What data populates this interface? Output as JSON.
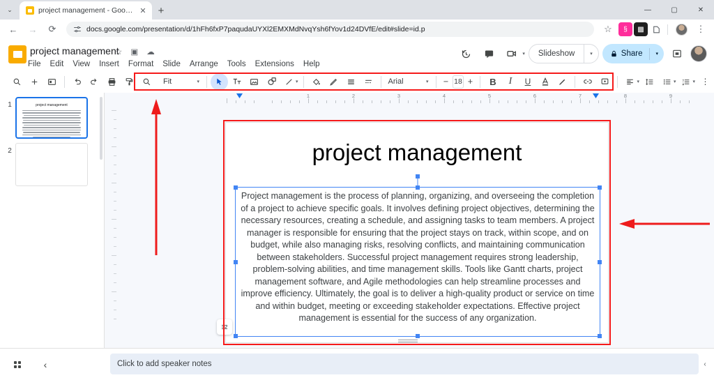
{
  "browser": {
    "tab": {
      "title": "project management - Google S",
      "favicon": "slides-favicon",
      "close": "✕"
    },
    "new_tab_label": "+",
    "tab_search": "⌄",
    "window_controls": {
      "minimize": "—",
      "maximize": "▢",
      "close": "✕"
    },
    "nav": {
      "back": "←",
      "forward": "→",
      "reload": "⟳"
    },
    "url": "docs.google.com/presentation/d/1hFh6fxP7paqudaUYXl2EMXMdNvqYsh6fYov1d24DVfE/edit#slide=id.p",
    "site_info_icon": "tune-icon",
    "bookmark_star": "☆",
    "extensions": [
      "extension-pink-icon",
      "extension-dark-icon",
      "extension-outline-icon"
    ],
    "menu": "⋮"
  },
  "docs": {
    "app_icon": "google-slides-icon",
    "title": "project management",
    "title_icons": [
      "star-icon",
      "move-to-folder-icon",
      "cloud-saved-icon"
    ],
    "menus": [
      "File",
      "Edit",
      "View",
      "Insert",
      "Format",
      "Slide",
      "Arrange",
      "Tools",
      "Extensions",
      "Help"
    ],
    "header_actions": {
      "history_icon": "version-history-icon",
      "comment_icon": "comment-icon",
      "meet_icon": "present-meet-icon",
      "meet_caret": "▾",
      "slideshow_label": "Slideshow",
      "slideshow_caret": "▾",
      "share_label": "Share",
      "share_lock_icon": "lock-icon",
      "share_caret": "▾",
      "present_icon": "present-icon",
      "avatar": "user-avatar"
    }
  },
  "toolbar": {
    "left_group": [
      {
        "name": "search-icon",
        "glyph": "🔍"
      },
      {
        "name": "add-slide-icon",
        "glyph": "+"
      },
      {
        "name": "layout-icon",
        "glyph": "▤"
      }
    ],
    "history_group": [
      {
        "name": "undo-icon",
        "glyph": "↶"
      },
      {
        "name": "redo-icon",
        "glyph": "↷"
      },
      {
        "name": "print-icon",
        "glyph": "⎙"
      },
      {
        "name": "paint-format-icon",
        "glyph": "⌸"
      },
      {
        "name": "zoom-icon",
        "glyph": "⌕"
      }
    ],
    "zoom_value": "Fit",
    "zoom_caret": "▾",
    "tools_group": [
      {
        "name": "select-cursor-icon",
        "glyph": "➤",
        "active": true
      },
      {
        "name": "text-box-icon",
        "glyph": "T"
      },
      {
        "name": "insert-image-icon",
        "glyph": "▣"
      },
      {
        "name": "shape-icon",
        "glyph": "◯"
      },
      {
        "name": "line-icon",
        "glyph": "╲"
      }
    ],
    "line_caret": "▾",
    "format_group": [
      {
        "name": "fill-color-icon",
        "glyph": "🪣"
      },
      {
        "name": "border-color-icon",
        "glyph": "✎"
      },
      {
        "name": "border-weight-icon",
        "glyph": "≡"
      },
      {
        "name": "border-dash-icon",
        "glyph": "┅"
      }
    ],
    "font_family": "Arial",
    "font_caret": "▾",
    "font_size_decrease": "−",
    "font_size": "18",
    "font_size_increase": "+",
    "text_format": [
      {
        "name": "bold-icon",
        "glyph": "B"
      },
      {
        "name": "italic-icon",
        "glyph": "I"
      },
      {
        "name": "underline-icon",
        "glyph": "U"
      },
      {
        "name": "text-color-icon",
        "glyph": "A"
      },
      {
        "name": "highlight-color-icon",
        "glyph": "✐"
      }
    ],
    "insert_group": [
      {
        "name": "insert-link-icon",
        "glyph": "⛓"
      },
      {
        "name": "insert-comment-icon",
        "glyph": "⊞"
      }
    ],
    "paragraph_group": [
      {
        "name": "align-icon",
        "glyph": "≡"
      },
      {
        "name": "line-spacing-icon",
        "glyph": "↕"
      },
      {
        "name": "bulleted-list-icon",
        "glyph": "☰"
      },
      {
        "name": "numbered-list-icon",
        "glyph": "⋮≡"
      }
    ],
    "more_options": "⋮",
    "collapse_toolbar": "⌃"
  },
  "filmstrip": {
    "slides": [
      {
        "number": "1",
        "title": "project management",
        "selected": true,
        "body_lines": 12
      },
      {
        "number": "2",
        "title": "",
        "selected": false,
        "body_lines": 0
      }
    ]
  },
  "ruler": {
    "horizontal_ticks": [
      "1",
      "2",
      "3",
      "4",
      "5",
      "6",
      "7",
      "8",
      "9"
    ],
    "indent_markers": 2
  },
  "slide": {
    "title": "project management",
    "body": "Project management is the process of planning, organizing, and overseeing the completion of a project to achieve specific goals. It involves defining project objectives, determining the necessary resources, creating a schedule, and assigning tasks to team members. A project manager is responsible for ensuring that the project stays on track, within scope, and on budget, while also managing risks, resolving conflicts, and maintaining communication between stakeholders. Successful project management requires strong leadership, problem-solving abilities, and time management skills. Tools like Gantt charts, project management software, and Agile methodologies can help streamline processes and improve efficiency. Ultimately, the goal is to deliver a high-quality product or service on time and within budget, meeting or exceeding stakeholder expectations. Effective project management is essential for the success of any organization.",
    "selection": "text-box-selected",
    "floating_button_icon": "format-options-icon"
  },
  "bottombar": {
    "grid_view_icon": "grid-view-icon",
    "collapse_icon": "‹",
    "speaker_notes_placeholder": "Click to add speaker notes",
    "expand_icon": "‹"
  },
  "annotations": {
    "toolbar_highlight_color": "#f61a1a",
    "slide_highlight_color": "#f61a1a",
    "arrow_up": "arrow-up-annotation",
    "arrow_right": "arrow-left-annotation"
  },
  "colors": {
    "accent": "#1a73e8",
    "share_bg": "#c2e7ff",
    "annotation": "#f61a1a",
    "logo": "#f9ab00"
  }
}
